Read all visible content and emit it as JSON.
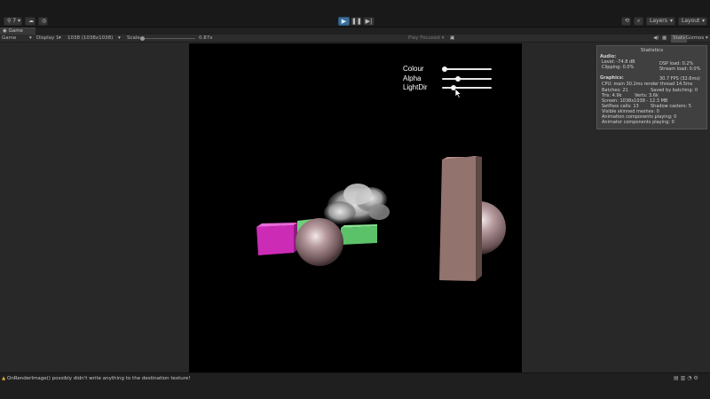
{
  "toolbar": {
    "account_label": "⚲ 7 ▾",
    "cloud_icon": "cloud-icon",
    "collab_icon": "collab-icon",
    "history_icon": "history-icon",
    "search_icon": "search-icon",
    "layers_label": "Layers",
    "layout_label": "Layout"
  },
  "tab": {
    "label": "Game"
  },
  "gamebar": {
    "view_select": "Game",
    "display_select": "Display 1",
    "resolution_select": "1038 (1038x1038)",
    "scale_label": "Scale",
    "scale_value": "0.87x",
    "play_focused": "Play Focused",
    "stats_label": "Stats",
    "gizmos_label": "Gizmos"
  },
  "game_ui": {
    "colour_label": "Colour",
    "alpha_label": "Alpha",
    "lightdir_label": "LightDir",
    "colour_value": 0.0,
    "alpha_value": 0.3,
    "lightdir_value": 0.2
  },
  "stats": {
    "title": "Statistics",
    "audio_header": "Audio:",
    "level": "Level: -74.8 dB",
    "clipping": "Clipping: 0.0%",
    "dsp_load": "DSP load: 0.2%",
    "stream_load": "Stream load: 0.0%",
    "graphics_header": "Graphics:",
    "fps": "30.7 FPS (32.6ms)",
    "cpu": "CPU: main 30.2ms  render thread 14.5ms",
    "batches": "Batches: 21",
    "saved_batching": "Saved by batching: 0",
    "tris": "Tris: 4.9k",
    "verts": "Verts: 3.6k",
    "screen": "Screen: 1038x1038 - 12.3 MB",
    "setpass": "SetPass calls: 13",
    "shadow_casters": "Shadow casters: 5",
    "skinned": "Visible skinned meshes: 0",
    "anim_components": "Animation components playing: 0",
    "animator_components": "Animator components playing: 0"
  },
  "status": {
    "warning_text": "OnRenderImage() possibly didn't write anything to the destination texture!"
  }
}
